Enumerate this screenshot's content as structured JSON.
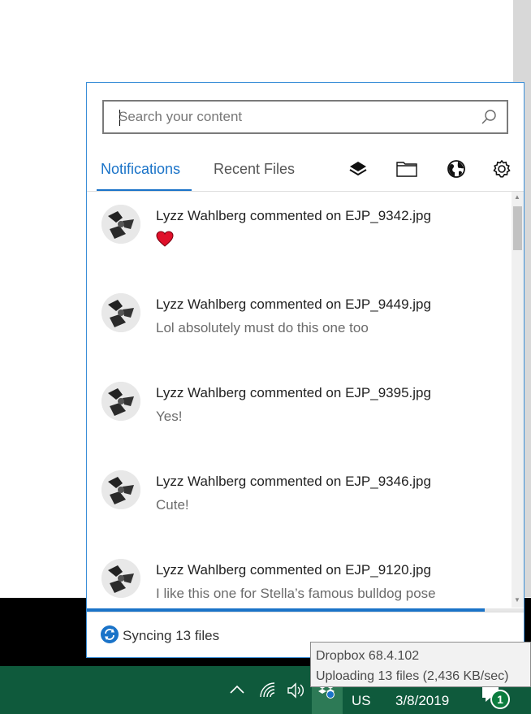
{
  "search": {
    "placeholder": "Search your content",
    "value": ""
  },
  "tabs": {
    "notifications": "Notifications",
    "recent_files": "Recent Files"
  },
  "toolbar": {
    "icons": [
      "layers-icon",
      "folder-icon",
      "globe-icon",
      "gear-icon"
    ]
  },
  "notifications": [
    {
      "title": "Lyzz Wahlberg commented on EJP_9342.jpg",
      "body": "",
      "emoji": "heart"
    },
    {
      "title": "Lyzz Wahlberg commented on EJP_9449.jpg",
      "body": "Lol absolutely must do this one too"
    },
    {
      "title": "Lyzz Wahlberg commented on EJP_9395.jpg",
      "body": "Yes!"
    },
    {
      "title": "Lyzz Wahlberg commented on EJP_9346.jpg",
      "body": "Cute!"
    },
    {
      "title": "Lyzz Wahlberg commented on EJP_9120.jpg",
      "body": "I like this one for Stella’s famous bulldog pose"
    }
  ],
  "sync": {
    "text": "Syncing 13 files",
    "progress": 0.91
  },
  "tooltip": {
    "line1": "Dropbox 68.4.102",
    "line2": "Uploading 13 files (2,436 KB/sec)"
  },
  "taskbar": {
    "language": "US",
    "date": "3/8/2019",
    "notification_count": "1"
  },
  "colors": {
    "accent": "#1a73c8",
    "taskbar": "#0f5a3c",
    "panel_border": "#3b8fd8",
    "heart": "#e0102a"
  }
}
